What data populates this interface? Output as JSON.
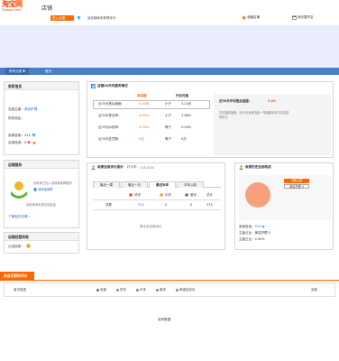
{
  "header": {
    "logo_cn": "淘宝网",
    "logo_en": "Taobao.com",
    "store_title": "店铺",
    "pill_label": "进入店铺",
    "search_text": "该店铺尚未获得评分",
    "collect_link": "收藏店铺",
    "free_store_link": "我也要开店"
  },
  "nav": {
    "items": [
      "所有分类 ▼",
      "首页"
    ]
  },
  "seller_info": {
    "title": "卖家信息",
    "nick_label": "当前主营：",
    "nick_value": "美容护理",
    "location_label": "所在地区：",
    "credit_label": "卖家信用：",
    "credit_value": "374",
    "buyer_credit_label": "买家信用：",
    "buyer_credit_value": "0"
  },
  "store_service": {
    "title": "店铺服务",
    "line1": "该卖家已加入消费者保障服务",
    "line2": "消费者保障",
    "line3": "该卖家尚未提交保证金",
    "more_link": "了解相关详情 ›"
  },
  "store_cert": {
    "title": "店铺经营资格",
    "label": "认证信息：",
    "badge_color": "#f0a030"
  },
  "service_30": {
    "title": "店铺30天内服务情况",
    "col_store": "本店铺",
    "col_industry": "行业均值",
    "rows": [
      {
        "label": "近30天售后速度：",
        "value": "0.00天",
        "cmp": "小于",
        "avg": "3.24天"
      },
      {
        "label": "近30天售后率：",
        "value": "0.00%",
        "cmp": "小于",
        "avg": "3.68%"
      },
      {
        "label": "近30天纠纷率：",
        "value": "0.00%",
        "cmp": "等于",
        "avg": "0.00%"
      },
      {
        "label": "近30天处罚数：",
        "value": "0次",
        "cmp": "等于",
        "avg": "0次"
      }
    ],
    "side_title": "近30天平均售后速度：",
    "side_value": "0.00",
    "side_desc": "平均退款速度：近30天卖家完结一笔退款申请平均花费的时长"
  },
  "credit_eval": {
    "title": "卖家信用评价展示",
    "good_rate_label": "好评率：",
    "good_rate_value": "100.00%",
    "tabs": [
      "最近一周",
      "最近一月",
      "最近半年",
      "半年以前"
    ],
    "cols": [
      "好评",
      "中评",
      "差评",
      "总计"
    ],
    "row_label": "总数",
    "row_values": [
      "374",
      "0",
      "0",
      "374"
    ],
    "footer": "暂无本店铺评价"
  },
  "seller_history": {
    "title": "卖家历史信用构成",
    "tag1": "当前主营",
    "tag2": "美容护理 0",
    "pie_color": "#f7a07b",
    "line1_label": "卖家信用：",
    "line1_value": "374",
    "line2_label": "主营占比：",
    "line2_value": "美容护理 0",
    "line3_label": "主营占比：",
    "line3_value": "0.00%"
  },
  "review_section": {
    "tab_label": "来自买家的评价",
    "filter_label": "宝贝信息",
    "options": [
      "全部",
      "好评",
      "中评",
      "差评",
      "有追加评论"
    ],
    "right_label": "买家",
    "empty": "没有数据"
  }
}
